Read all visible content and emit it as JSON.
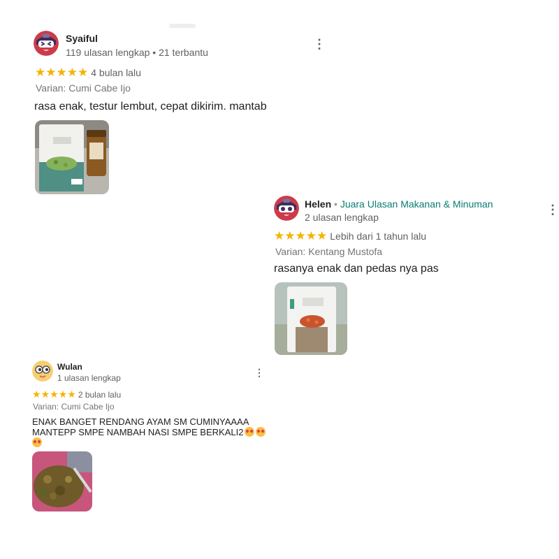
{
  "reviews": [
    {
      "name": "Syaiful",
      "stats": "119 ulasan lengkap • 21 terbantu",
      "stars": 5,
      "time_ago": "4 bulan lalu",
      "variant": "Varian: Cumi Cabe Ijo",
      "comment": "rasa enak, testur lembut, cepat dikirim. mantab",
      "more_icon": "more-vertical-icon"
    },
    {
      "name": "Helen",
      "badge": "Juara Ulasan Makanan & Minuman",
      "stats": "2 ulasan lengkap",
      "stars": 5,
      "time_ago": "Lebih dari 1 tahun lalu",
      "variant": "Varian: Kentang Mustofa",
      "comment": "rasanya enak dan pedas nya pas",
      "more_icon": "more-vertical-icon"
    },
    {
      "name": "Wulan",
      "stats": "1 ulasan lengkap",
      "stars": 5,
      "time_ago": "2 bulan lalu",
      "variant": "Varian: Cumi Cabe Ijo",
      "comment_line1": "ENAK BANGET RENDANG AYAM SM CUMINYAAAA",
      "comment_line2": "MANTEPP SMPE NAMBAH NASI SMPE BERKALI2",
      "more_icon": "more-vertical-icon"
    }
  ],
  "star_glyph": "★",
  "more_glyph": "⋮",
  "colors": {
    "star": "#f5b301",
    "badge": "#0a7c72",
    "muted": "#616161"
  }
}
